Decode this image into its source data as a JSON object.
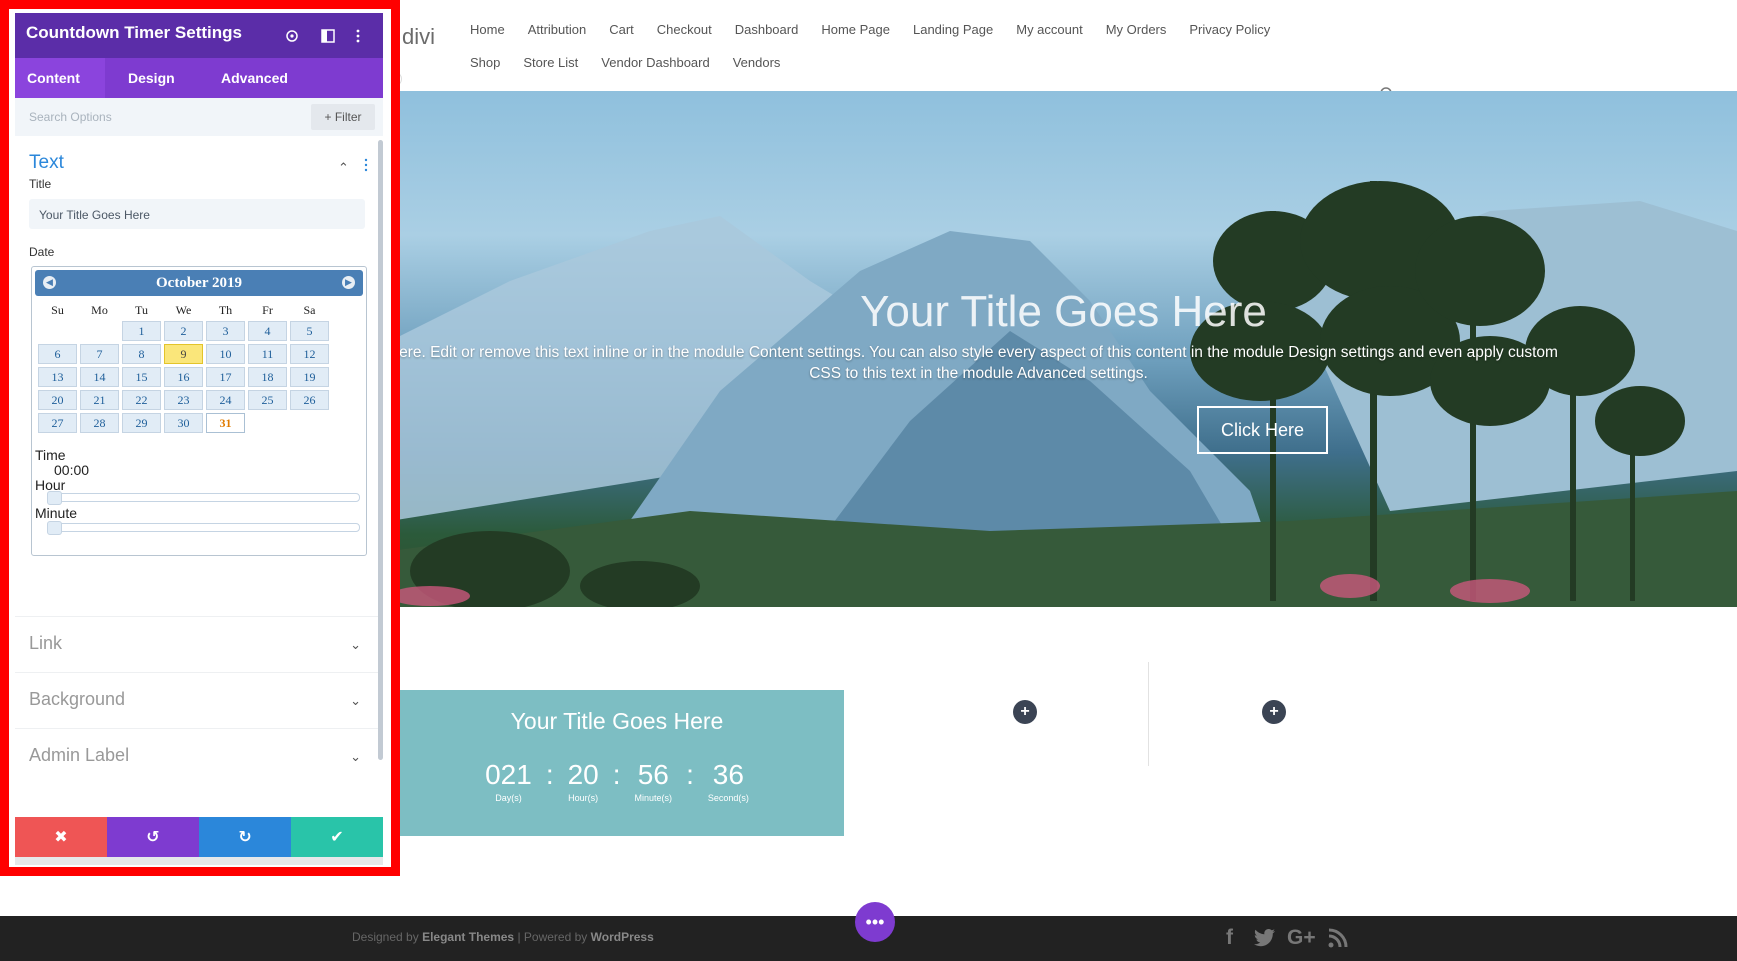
{
  "header": {
    "logo_text": "divi",
    "nav_row1": [
      "Home",
      "Attribution",
      "Cart",
      "Checkout",
      "Dashboard",
      "Home Page",
      "Landing Page",
      "My account",
      "My Orders",
      "Privacy Policy"
    ],
    "nav_row2": [
      "Shop",
      "Store List",
      "Vendor Dashboard",
      "Vendors"
    ]
  },
  "hero": {
    "title": "Your Title Goes Here",
    "text": "ere. Edit or remove this text inline or in the module Content settings. You can also style every aspect of this content in the module Design settings and even apply custom CSS to this text in the module Advanced settings.",
    "button_label": "Click Here"
  },
  "countdown": {
    "title": "Your Title Goes Here",
    "units": [
      {
        "value": "021",
        "label": "Day(s)"
      },
      {
        "value": "20",
        "label": "Hour(s)"
      },
      {
        "value": "56",
        "label": "Minute(s)"
      },
      {
        "value": "36",
        "label": "Second(s)"
      }
    ],
    "separator": ":",
    "add_icon": "+",
    "accent_color": "#7dbec3"
  },
  "footer": {
    "designed_by": "Designed by",
    "elegant": "Elegant Themes",
    "divider": "|",
    "powered_by": "Powered by",
    "wordpress": "WordPress",
    "social": [
      "f",
      "G+"
    ],
    "fab_label": "•••"
  },
  "panel": {
    "title": "Countdown Timer Settings",
    "header_icons": [
      "target-icon",
      "layout-icon",
      "more-icon"
    ],
    "tabs": [
      "Content",
      "Design",
      "Advanced"
    ],
    "active_tab": "Content",
    "search_placeholder": "Search Options",
    "filter_label": "+ Filter",
    "text_section": {
      "title": "Text",
      "title_label": "Title",
      "title_value": "Your Title Goes Here",
      "date_label": "Date"
    },
    "datepicker": {
      "month": "October 2019",
      "weekdays": [
        "Su",
        "Mo",
        "Tu",
        "We",
        "Th",
        "Fr",
        "Sa"
      ],
      "weeks": [
        [
          "",
          "",
          "1",
          "2",
          "3",
          "4",
          "5"
        ],
        [
          "6",
          "7",
          "8",
          "9",
          "10",
          "11",
          "12"
        ],
        [
          "13",
          "14",
          "15",
          "16",
          "17",
          "18",
          "19"
        ],
        [
          "20",
          "21",
          "22",
          "23",
          "24",
          "25",
          "26"
        ],
        [
          "27",
          "28",
          "29",
          "30",
          "31",
          "",
          ""
        ]
      ],
      "highlighted_day": "9",
      "today_day": "31",
      "time_label": "Time",
      "time_value": "00:00",
      "hour_label": "Hour",
      "minute_label": "Minute"
    },
    "collapsed_sections": [
      "Link",
      "Background",
      "Admin Label"
    ],
    "actions": [
      {
        "name": "discard",
        "glyph": "✖",
        "color": "#ef5555"
      },
      {
        "name": "undo",
        "glyph": "↺",
        "color": "#7e3bd0"
      },
      {
        "name": "redo",
        "glyph": "↻",
        "color": "#2b87da"
      },
      {
        "name": "save",
        "glyph": "✔",
        "color": "#29c4a9"
      }
    ],
    "colors": {
      "header": "#5b2da8",
      "tabs": "#7e3bd0",
      "section_accent": "#2b87da",
      "highlight_frame": "#ff0000"
    }
  }
}
